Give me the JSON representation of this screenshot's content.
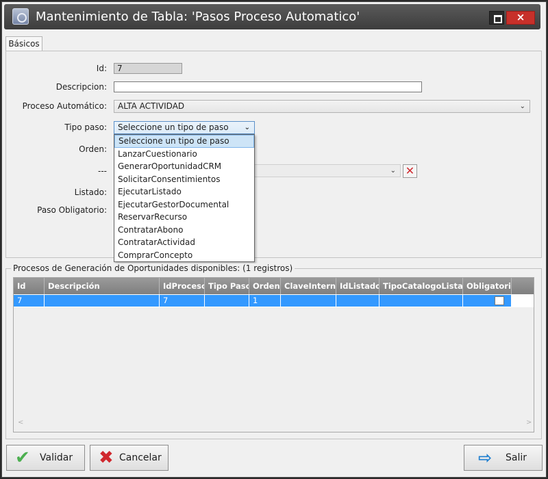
{
  "window": {
    "title": "Mantenimiento de Tabla: 'Pasos Proceso Automatico'",
    "close_glyph": "×"
  },
  "tabs": [
    {
      "label": "Básicos"
    }
  ],
  "form": {
    "id_label": "Id:",
    "id_value": "7",
    "descripcion_label": "Descripcion:",
    "descripcion_value": "",
    "proceso_label": "Proceso Automático:",
    "proceso_value": "ALTA ACTIVIDAD",
    "tipo_label": "Tipo paso:",
    "tipo_value": "Seleccione un tipo de paso",
    "orden_label": "Orden:",
    "dashes_label": "---",
    "listado_label": "Listado:",
    "obligatorio_label": "Paso Obligatorio:"
  },
  "dropdown": {
    "options": [
      "Seleccione un tipo de paso",
      "LanzarCuestionario",
      "GenerarOportunidadCRM",
      "SolicitarConsentimientos",
      "EjecutarListado",
      "EjecutarGestorDocumental",
      "ReservarRecurso",
      "ContratarAbono",
      "ContratarActividad",
      "ComprarConcepto"
    ],
    "selected_index": 0
  },
  "grid": {
    "title": "Procesos de Generación de Oportunidades disponibles:  (1 registros)",
    "columns": [
      "Id",
      "Descripción",
      "IdProceso",
      "Tipo Paso",
      "Orden",
      "ClaveInterna",
      "IdListado",
      "TipoCatalogoListado",
      "Obligatorio"
    ],
    "rows": [
      [
        "7",
        "",
        "7",
        "",
        "1",
        "",
        "",
        "",
        ""
      ]
    ]
  },
  "buttons": {
    "validar": "Validar",
    "cancelar": "Cancelar",
    "salir": "Salir"
  },
  "colors": {
    "selection": "#3399ff",
    "close": "#c7302a",
    "accept": "#4caf50",
    "cancel": "#d0282e"
  }
}
